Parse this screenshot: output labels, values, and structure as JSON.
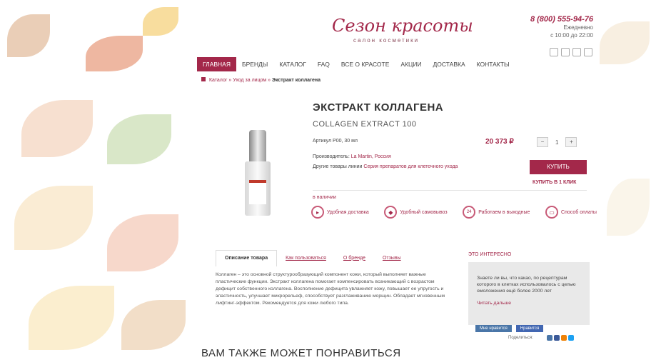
{
  "header": {
    "logo_text": "Сезон красоты",
    "logo_sub": "салон косметики",
    "phone": "8 (800) 555-94-76",
    "hours_days": "Ежедневно",
    "hours_time": "с 10:00 до 22:00"
  },
  "nav": {
    "items": [
      {
        "label": "Главная",
        "active": true
      },
      {
        "label": "Бренды",
        "active": false
      },
      {
        "label": "Каталог",
        "active": false
      },
      {
        "label": "FAQ",
        "active": false
      },
      {
        "label": "Все о красоте",
        "active": false
      },
      {
        "label": "Акции",
        "active": false
      },
      {
        "label": "Доставка",
        "active": false
      },
      {
        "label": "Контакты",
        "active": false
      }
    ]
  },
  "breadcrumbs": {
    "items": [
      "Каталог",
      "Уход за лицом"
    ],
    "current": "Экстракт коллагена"
  },
  "product": {
    "title": "ЭКСТРАКТ КОЛЛАГЕНА",
    "subtitle": "COLLAGEN EXTRACT 100",
    "article": "Артикул P00, 30 мл",
    "price": "20 373 ₽",
    "quantity": "1",
    "manufacturer_label": "Производитель:",
    "manufacturer_value": "La Martin, Россия",
    "other_label": "Другие товары линии",
    "other_value": "Серия препаратов для клеточного ухода",
    "buy_label": "Купить",
    "one_click_label": "Купить в 1 клик",
    "in_stock": "в наличии"
  },
  "features": [
    {
      "label": "Удобная доставка",
      "icon": "truck-icon"
    },
    {
      "label": "Удобный самовывоз",
      "icon": "bag-icon"
    },
    {
      "label": "Работаем в выходные",
      "icon": "24-7-icon"
    },
    {
      "label": "Способ оплаты",
      "icon": "card-icon"
    }
  ],
  "tabs": [
    {
      "label": "Описание товара",
      "active": true
    },
    {
      "label": "Как пользоваться",
      "active": false
    },
    {
      "label": "О бренде",
      "active": false
    },
    {
      "label": "Отзывы",
      "active": false
    }
  ],
  "description": "Коллаген – это основной структурообразующий компонент кожи, который выполняет важные пластические функции. Экстракт коллагена помогает компенсировать возникающий с возрастом дефицит собственного коллагена. Восполнение дефицита увлажняет кожу, повышает ее упругость и эластичность, улучшает микрорельеф, способствует разглаживанию морщин. Обладает мгновенным лифтинг-эффектом. Рекомендуется для кожи любого типа.",
  "sidebar": {
    "title": "Это интересно",
    "text": "Знаете ли вы, что какао, по рецептурам которого в клетках использовалось с целью омоложения ещё более 2000 лет",
    "more": "Читать дальше"
  },
  "share": {
    "buttons": [
      "Мне нравится",
      "Нравится"
    ],
    "label": "Поделиться:"
  },
  "also_like": "ВАМ ТАКЖЕ МОЖЕТ ПОНРАВИТЬСЯ",
  "colors": {
    "accent": "#a3284a",
    "sidebar_bg": "#e9e9e9"
  }
}
